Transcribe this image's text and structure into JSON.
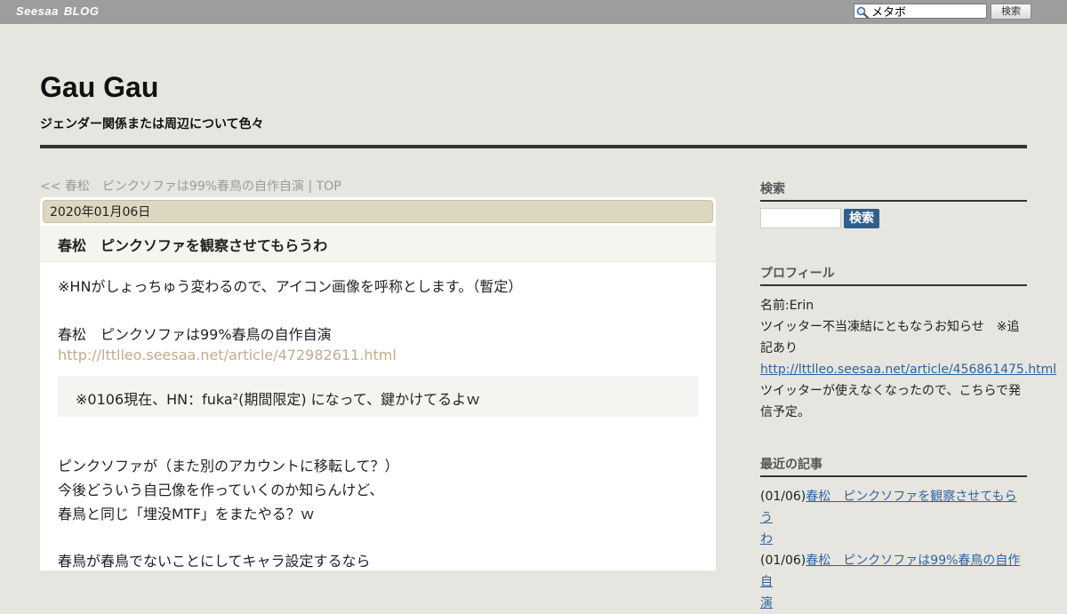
{
  "topbar": {
    "logo_brand": "Seesaa",
    "logo_blog": "BLOG",
    "search_value": "メタボ",
    "search_button": "検索",
    "icon": "magnifier-icon"
  },
  "header": {
    "title": "Gau Gau",
    "description": "ジェンダー関係または周辺について色々"
  },
  "nav": {
    "prev_link": "<< 春松　ピンクソファは99%春鳥の自作自演",
    "separator": " | ",
    "top_link": "TOP"
  },
  "post": {
    "date": "2020年01月06日",
    "title": "春松　ピンクソファを観察させてもらうわ",
    "lines": [
      "※HNがしょっちゅう変わるので、アイコン画像を呼称とします。（暫定）",
      "春松　ピンクソファは99%春鳥の自作自演",
      "ピンクソファが（また別のアカウントに移転して？）",
      "今後どういう自己像を作っていくのか知らんけど、",
      "春鳥と同じ「埋没MTF」をまたやる？ｗ",
      "春鳥が春鳥でないことにしてキャラ設定するなら"
    ],
    "link": "http://lttlleo.seesaa.net/article/472982611.html",
    "quote": "※0106現在、HN：fuka²(期間限定) になって、鍵かけてるよｗ"
  },
  "sidebar": {
    "search_heading": "検索",
    "search_button": "検索",
    "profile_heading": "プロフィール",
    "profile_name": "名前:Erin",
    "profile_notice_1": "ツイッター不当凍結にともなうお知らせ　※追",
    "profile_notice_2": "記あり",
    "profile_link": "http://lttlleo.seesaa.net/article/456861475.html",
    "profile_text_1": "ツイッターが使えなくなったので、こちらで発",
    "profile_text_2": "信予定。",
    "recent_heading": "最近の記事",
    "recent": [
      {
        "date": "(01/06)",
        "title_1": "春松　ピンクソファを観察させてもらう",
        "title_2": "わ"
      },
      {
        "date": "(01/06)",
        "title_1": "春松　ピンクソファは99%春鳥の自作自",
        "title_2": "演"
      }
    ]
  },
  "colors": {
    "topbar": "#9d9d9d",
    "page_bg": "#e7e5e0",
    "date_bar": "#ddd6c0",
    "link": "#2e64a0",
    "post_link": "#c0ad8a",
    "search_button": "#2f5f8f"
  }
}
